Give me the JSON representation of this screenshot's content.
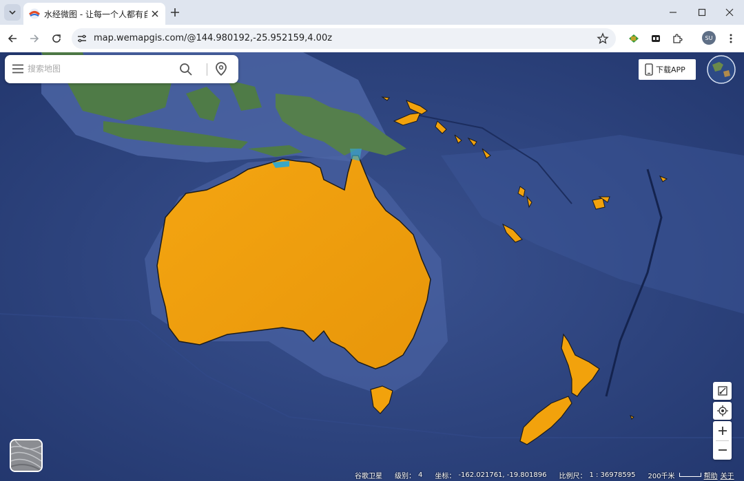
{
  "browser": {
    "tab_title": "水经微图 - 让每一个人都有自己",
    "url": "map.wemapgis.com/@144.980192,-25.952159,4.00z",
    "profile_initials": "SU"
  },
  "map": {
    "search_placeholder": "搜索地图",
    "download_app_label": "下载APP",
    "status": {
      "layer_name": "谷歌卫星",
      "level_label": "级别：",
      "level_value": "4",
      "coord_label": "坐标：",
      "coord_value": "-162.021761, -19.801896",
      "scale_label": "比例尺：",
      "scale_value": "1 : 36978595",
      "scale_bar_text": "200千米",
      "help_link": "帮助",
      "about_link": "关于"
    },
    "colors": {
      "highlight": "#f2a20c",
      "ocean": "#2a3f77"
    }
  }
}
